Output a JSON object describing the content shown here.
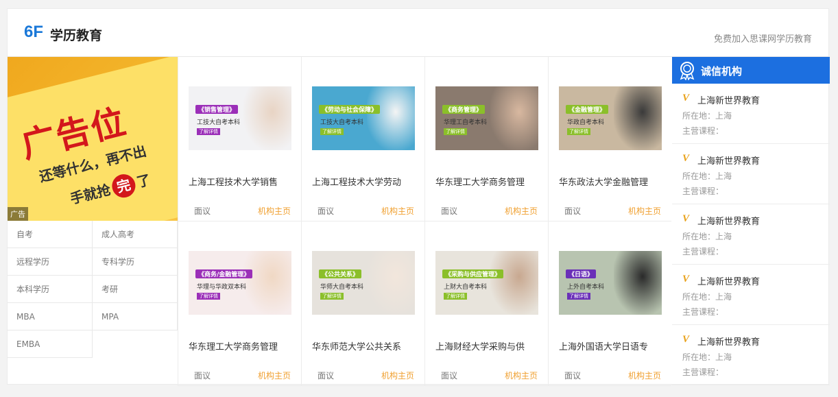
{
  "header": {
    "floor_number": "6F",
    "floor_title": "学历教育",
    "join_link": "免费加入思课网学历教育"
  },
  "ad": {
    "headline": "广告位",
    "line1": "还等什么，再不出",
    "line2_prefix": "手就抢",
    "line2_circle": "完",
    "line2_suffix": "了",
    "tag": "广告",
    "colors": {
      "bg": "#f0a81e",
      "band": "#fde067",
      "text": "#d3171c"
    }
  },
  "categories": [
    {
      "label": "自考"
    },
    {
      "label": "成人高考"
    },
    {
      "label": "远程学历"
    },
    {
      "label": "专科学历"
    },
    {
      "label": "本科学历"
    },
    {
      "label": "考研"
    },
    {
      "label": "MBA"
    },
    {
      "label": "MPA"
    },
    {
      "label": "EMBA"
    }
  ],
  "courses": [
    {
      "title": "上海工程技术大学销售",
      "price": "面议",
      "link": "机构主页",
      "banner": "《销售管理》",
      "sub": "工技大自考本科",
      "btn": "了解详情",
      "banner_color": "#9b2fb8",
      "bg": "#f2f2f4",
      "person": "#e8d4c4"
    },
    {
      "title": "上海工程技术大学劳动",
      "price": "面议",
      "link": "机构主页",
      "banner": "《劳动与社会保障》",
      "sub": "工技大自考本科",
      "btn": "了解详情",
      "banner_color": "#8bbf2a",
      "bg": "#4aa8d0",
      "person": "#f4f4f4"
    },
    {
      "title": "华东理工大学商务管理",
      "price": "面议",
      "link": "机构主页",
      "banner": "《商务管理》",
      "sub": "华理工自考本科",
      "btn": "了解详情",
      "banner_color": "#8bbf2a",
      "bg": "#8a7a6e",
      "person": "#d8b8a0"
    },
    {
      "title": "华东政法大学金融管理",
      "price": "面议",
      "link": "机构主页",
      "banner": "《金融管理》",
      "sub": "华政自考本科",
      "btn": "了解详情",
      "banner_color": "#8bbf2a",
      "bg": "#c9b8a0",
      "person": "#3a3a3a"
    },
    {
      "title": "华东理工大学商务管理",
      "price": "面议",
      "link": "机构主页",
      "banner": "《商务/金融管理》",
      "sub": "华理与华政双本科",
      "btn": "了解详情",
      "banner_color": "#9b2fb8",
      "bg": "#f6ecec",
      "person": "#f0d8c4"
    },
    {
      "title": "华东师范大学公共关系",
      "price": "面议",
      "link": "机构主页",
      "banner": "《公共关系》",
      "sub": "华师大自考本科",
      "btn": "了解详情",
      "banner_color": "#8bbf2a",
      "bg": "#e6e2dc",
      "person": "#f2e6dc"
    },
    {
      "title": "上海财经大学采购与供",
      "price": "面议",
      "link": "机构主页",
      "banner": "《采购与供应管理》",
      "sub": "上财大自考本科",
      "btn": "了解详情",
      "banner_color": "#8bbf2a",
      "bg": "#e8e4dc",
      "person": "#c8a890"
    },
    {
      "title": "上海外国语大学日语专",
      "price": "面议",
      "link": "机构主页",
      "banner": "《日语》",
      "sub": "上外自考本科",
      "btn": "了解详情",
      "banner_color": "#6a2fb8",
      "bg": "#b8c4b0",
      "person": "#2a2a2a"
    }
  ],
  "trust": {
    "title": "诚信机构",
    "color": "#1c6fe0",
    "orgs": [
      {
        "v": "V",
        "name": "上海新世界教育",
        "location": "所在地：上海",
        "courses": "主营课程："
      },
      {
        "v": "V",
        "name": "上海新世界教育",
        "location": "所在地：上海",
        "courses": "主营课程："
      },
      {
        "v": "V",
        "name": "上海新世界教育",
        "location": "所在地：上海",
        "courses": "主营课程："
      },
      {
        "v": "V",
        "name": "上海新世界教育",
        "location": "所在地：上海",
        "courses": "主营课程："
      },
      {
        "v": "V",
        "name": "上海新世界教育",
        "location": "所在地：上海",
        "courses": "主营课程："
      }
    ]
  },
  "icons": {
    "trust": "certificate-badge-icon",
    "verified": "v-verified-icon"
  }
}
